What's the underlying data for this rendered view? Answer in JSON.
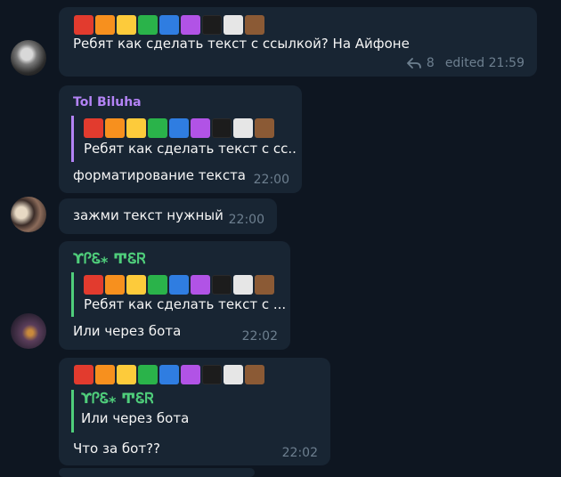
{
  "emoji_colors": [
    "#e23b2e",
    "#f7901e",
    "#fdcb3b",
    "#2ab34a",
    "#2f7de1",
    "#b153e6",
    "#1c1c1c",
    "#e6e6e6",
    "#8b5a35"
  ],
  "messages": [
    {
      "text": "Ребят как сделать текст с ссылкой? На Айфоне",
      "replies_count": "8",
      "time": "edited 21:59"
    },
    {
      "sender": "Tol Biluha",
      "sender_color": "#b383f5",
      "quote_text": "Ребят как сделать текст с сс...",
      "text": "форматирование текста",
      "time": "22:00"
    },
    {
      "text": "зажми текст нужный",
      "time": "22:00"
    },
    {
      "sender": "ϒᎵᏋ⁎ ͲᏋᏒ",
      "sender_color": "#4fce7b",
      "quote_text": "Ребят как сделать текст с ...",
      "text": "Или через бота",
      "time": "22:02"
    },
    {
      "quote_author": "ϒᎵᏋ⁎ ͲᏋᏒ",
      "quote_text": "Или через бота",
      "text": "Что за бот??",
      "time": "22:02"
    }
  ],
  "colors": {
    "quote_bar_green": "#4fce7b",
    "quote_bar_purple": "#b383f5",
    "bubble": "#182533",
    "background": "#0e1621"
  }
}
